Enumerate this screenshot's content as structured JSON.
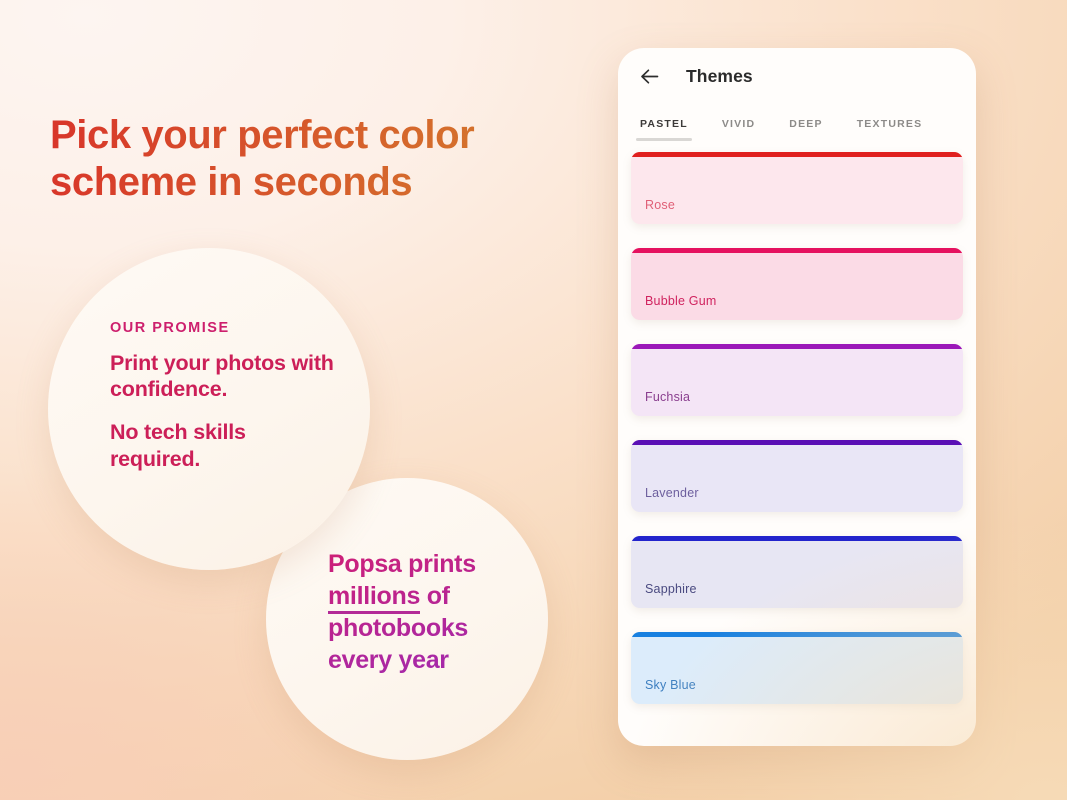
{
  "promo": {
    "headline": "Pick your perfect color scheme in seconds",
    "headline_gradient_from": "#d8352a",
    "headline_gradient_to": "#d4792c",
    "promise_bubble": {
      "eyebrow": "OUR PROMISE",
      "line1": "Print your photos with confidence.",
      "line2": "No tech skills required.",
      "eyebrow_color": "#cd1f6d",
      "text_color": "#cc1f58"
    },
    "stat_bubble": {
      "text_before": "Popsa prints ",
      "text_underlined": "millions",
      "text_after": " of photobooks every year",
      "gradient_from": "#cf1f76",
      "gradient_to": "#9c2bb5"
    }
  },
  "phone": {
    "back_icon": "arrow-left-icon",
    "title": "Themes",
    "tabs": [
      {
        "label": "PASTEL",
        "active": true
      },
      {
        "label": "VIVID",
        "active": false
      },
      {
        "label": "DEEP",
        "active": false
      },
      {
        "label": "TEXTURES",
        "active": false
      }
    ],
    "themes": [
      {
        "name": "Rose",
        "bar": "#e0201f",
        "body": "#fde7ed",
        "text": "#e06077"
      },
      {
        "name": "Bubble Gum",
        "bar": "#e5115f",
        "body": "#fbdbe6",
        "text": "#d0235f"
      },
      {
        "name": "Fuchsia",
        "bar": "#9b18b8",
        "body": "#f4e5f6",
        "text": "#8a3f8f"
      },
      {
        "name": "Lavender",
        "bar": "#5a0fb5",
        "body": "#e9e6f6",
        "text": "#6d5f9e"
      },
      {
        "name": "Sapphire",
        "bar": "#2324cc",
        "body": "#e7e6f3",
        "text": "#4a4a80"
      },
      {
        "name": "Sky Blue",
        "bar": "#1880e0",
        "body": "#dcecfb",
        "text": "#3d7fc0"
      }
    ]
  }
}
